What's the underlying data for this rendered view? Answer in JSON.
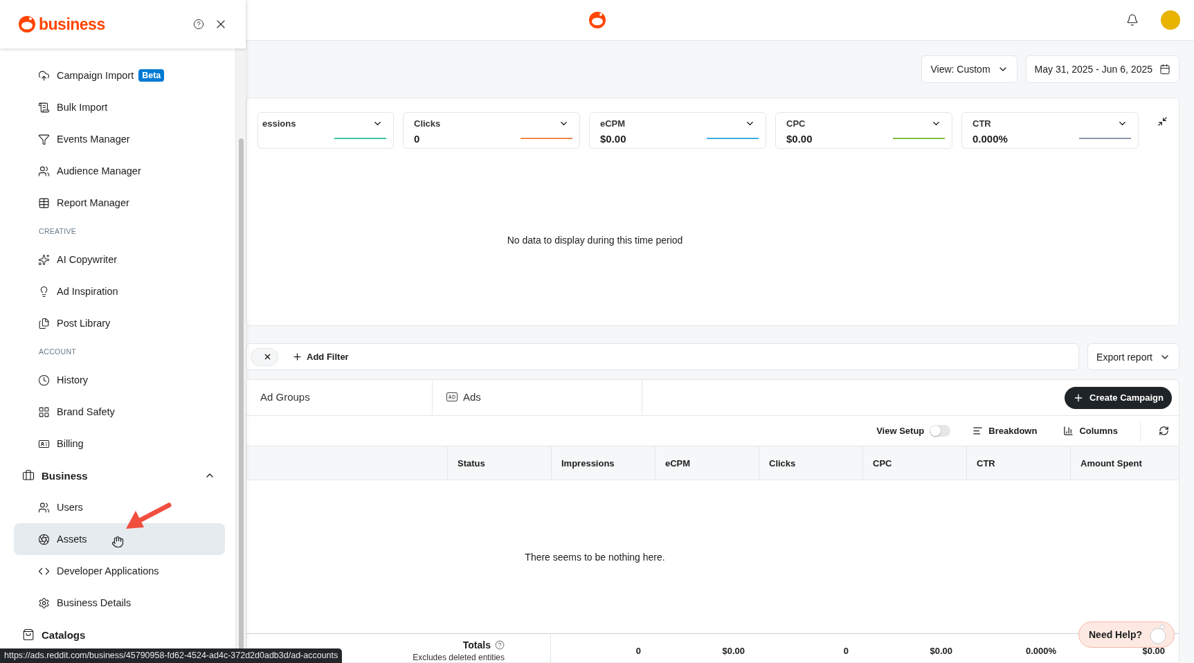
{
  "sidebar": {
    "brand": "business",
    "items": [
      {
        "kind": "link",
        "label": "Campaign Import",
        "badge": "Beta",
        "selected": false
      },
      {
        "kind": "link",
        "label": "Bulk Import",
        "selected": false
      },
      {
        "kind": "link",
        "label": "Events Manager",
        "selected": false
      },
      {
        "kind": "link",
        "label": "Audience Manager",
        "selected": false
      },
      {
        "kind": "link",
        "label": "Report Manager",
        "selected": false
      },
      {
        "kind": "section",
        "label": "CREATIVE"
      },
      {
        "kind": "link",
        "label": "AI Copywriter",
        "selected": false
      },
      {
        "kind": "link",
        "label": "Ad Inspiration",
        "selected": false
      },
      {
        "kind": "link",
        "label": "Post Library",
        "selected": false
      },
      {
        "kind": "section",
        "label": "ACCOUNT"
      },
      {
        "kind": "link",
        "label": "History",
        "selected": false
      },
      {
        "kind": "link",
        "label": "Brand Safety",
        "selected": false
      },
      {
        "kind": "link",
        "label": "Billing",
        "selected": false
      },
      {
        "kind": "group",
        "label": "Business",
        "expanded": true,
        "children": [
          {
            "kind": "link",
            "label": "Users",
            "selected": false
          },
          {
            "kind": "link",
            "label": "Assets",
            "selected": true
          },
          {
            "kind": "link",
            "label": "Developer Applications",
            "selected": false
          },
          {
            "kind": "link",
            "label": "Business Details",
            "selected": false
          }
        ]
      },
      {
        "kind": "group",
        "label": "Catalogs",
        "expanded": false
      }
    ]
  },
  "view_select": {
    "value": "View: Custom"
  },
  "date_range": {
    "value": "May 31, 2025 - Jun 6, 2025"
  },
  "metrics": [
    {
      "label": "essions",
      "color": "#3cc3a8"
    },
    {
      "label": "Clicks",
      "value": "0",
      "color": "#f0894a"
    },
    {
      "label": "eCPM",
      "value": "$0.00",
      "color": "#3aaee0"
    },
    {
      "label": "CPC",
      "value": "$0.00",
      "color": "#7cc242"
    },
    {
      "label": "CTR",
      "value": "0.000%",
      "color": "#8a99a8"
    }
  ],
  "chart_message": "No data to display during this time period",
  "filter_bar": {
    "add_filter": "Add Filter"
  },
  "export_button": "Export report",
  "level_tabs": [
    {
      "label": "Ad Groups",
      "selected": false
    },
    {
      "label": "Ads",
      "selected": false
    }
  ],
  "create_button": "Create Campaign",
  "toolbar": {
    "view_setup": {
      "label": "View Setup",
      "on": false
    },
    "breakdown": "Breakdown",
    "columns": "Columns"
  },
  "table": {
    "columns": [
      "Status",
      "Impressions",
      "eCPM",
      "Clicks",
      "CPC",
      "CTR",
      "Amount Spent"
    ],
    "empty_message": "There seems to be nothing here.",
    "totals": {
      "label": "Totals",
      "note": "Excludes deleted entities",
      "values": [
        "0",
        "$0.00",
        "0",
        "$0.00",
        "0.000%",
        "$0.00"
      ]
    }
  },
  "help_button": "Need Help?",
  "status_url": "https://ads.reddit.com/business/45790958-fd62-4524-ad4c-372d2d0adb3d/ad-accounts"
}
